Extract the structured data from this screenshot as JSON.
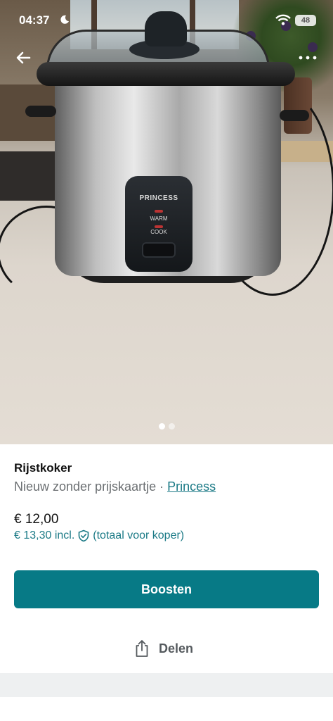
{
  "status_bar": {
    "time": "04:37",
    "battery": "48",
    "icons": [
      "moon-icon",
      "wifi-icon",
      "battery-icon"
    ]
  },
  "photo": {
    "panel_brand": "PRINCESS",
    "panel_labels": [
      "WARM",
      "COOK"
    ],
    "image_count": 2,
    "active_image": 1
  },
  "nav": {
    "back_icon": "arrow-left-icon",
    "more_icon": "more-dots-icon"
  },
  "listing": {
    "title": "Rijstkoker",
    "condition": "Nieuw zonder prijskaartje",
    "separator": " · ",
    "brand": "Princess",
    "price": "€ 12,00",
    "price_incl": "€ 13,30 incl.",
    "buyer_total_note": "(totaal voor koper)"
  },
  "actions": {
    "boost_label": "Boosten",
    "share_label": "Delen"
  },
  "colors": {
    "accent": "#077a86",
    "link": "#1b7a86",
    "muted_text": "#6b6f72",
    "band": "#eef0f1"
  }
}
